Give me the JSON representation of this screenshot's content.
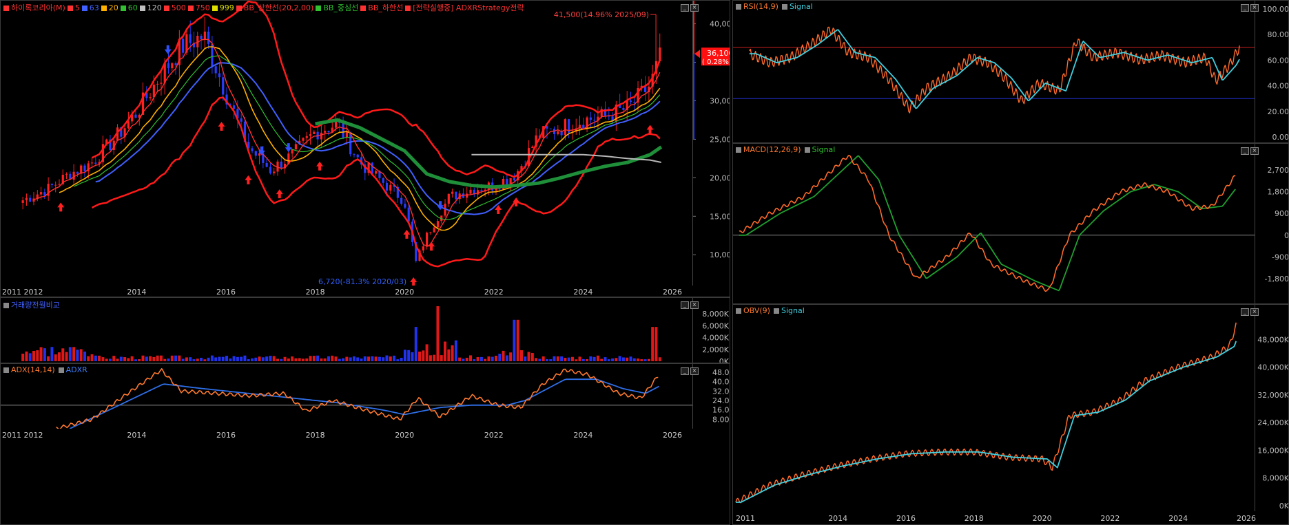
{
  "main": {
    "legend": [
      {
        "label": "하이록코리아(M)",
        "color": "#ff3030"
      },
      {
        "label": "5",
        "color": "#ff3030"
      },
      {
        "label": "63",
        "color": "#4060ff"
      },
      {
        "label": "20",
        "color": "#ffb000"
      },
      {
        "label": "60",
        "color": "#30c030"
      },
      {
        "label": "120",
        "color": "#c0c0c0"
      },
      {
        "label": "500",
        "color": "#ff3030"
      },
      {
        "label": "750",
        "color": "#ff3030"
      },
      {
        "label": "999",
        "color": "#e0e000"
      },
      {
        "label": "BB_상한선(20,2,00)",
        "color": "#ff3030"
      },
      {
        "label": "BB_중심선",
        "color": "#30c030"
      },
      {
        "label": "BB_하한선",
        "color": "#ff3030"
      },
      {
        "label": "[전략실행중] ADXRStrategy전략",
        "color": "#ff3030"
      }
    ],
    "high_label": "41,500(14.96% 2025/09)",
    "low_label": "6,720(-81.3% 2020/03)",
    "price_tag": "36,100",
    "price_tag_pct": "( 0.28%)",
    "y_ticks": [
      "40,000",
      "35,000",
      "30,000",
      "25,000",
      "20,000",
      "15,000",
      "10,000"
    ],
    "x_labels": [
      "2011 2012",
      "2014",
      "2016",
      "2018",
      "2020",
      "2022",
      "2024",
      "2026"
    ]
  },
  "volume": {
    "title": "거래량전월비교",
    "y_ticks": [
      "8,000K",
      "6,000K",
      "4,000K",
      "2,000K",
      "0K"
    ]
  },
  "adx": {
    "title1": "ADX(14,14)",
    "title2": "ADXR",
    "y_ticks": [
      "48.00",
      "40.00",
      "32.00",
      "24.00",
      "16.00",
      "8.00"
    ],
    "x_labels": [
      "2011 2012",
      "2014",
      "2016",
      "2018",
      "2020",
      "2022",
      "2024",
      "2026"
    ]
  },
  "rsi": {
    "title1": "RSI(14,9)",
    "title2": "Signal",
    "y_ticks": [
      "100.00",
      "80.00",
      "60.00",
      "40.00",
      "20.00",
      "0.00"
    ]
  },
  "macd": {
    "title1": "MACD(12,26,9)",
    "title2": "Signal",
    "y_ticks": [
      "2,700",
      "1,800",
      "900",
      "0",
      "-900",
      "-1,800"
    ]
  },
  "obv": {
    "title1": "OBV(9)",
    "title2": "Signal",
    "y_ticks": [
      "48,000K",
      "40,000K",
      "32,000K",
      "24,000K",
      "16,000K",
      "8,000K",
      "0K"
    ],
    "x_labels": [
      "2011",
      "2014",
      "2016",
      "2018",
      "2020",
      "2022",
      "2024",
      "2026"
    ]
  },
  "chart_data": {
    "type": "line",
    "title": "하이록코리아(M)",
    "x": [
      "2011-06",
      "2012-01",
      "2012-07",
      "2013-01",
      "2013-07",
      "2014-01",
      "2014-07",
      "2015-01",
      "2015-07",
      "2016-01",
      "2016-07",
      "2017-01",
      "2017-07",
      "2018-01",
      "2018-07",
      "2019-01",
      "2019-07",
      "2020-01",
      "2020-04",
      "2020-07",
      "2021-01",
      "2021-07",
      "2022-01",
      "2022-07",
      "2023-01",
      "2023-07",
      "2024-01",
      "2024-07",
      "2025-01",
      "2025-07",
      "2025-10"
    ],
    "series": [
      {
        "name": "하이록코리아(M)",
        "values": [
          17000,
          18500,
          20500,
          22000,
          25000,
          28500,
          33000,
          37000,
          38500,
          31000,
          24000,
          21000,
          23000,
          26000,
          27000,
          22000,
          19500,
          17000,
          9000,
          12500,
          17500,
          18500,
          19000,
          20500,
          25500,
          26500,
          27500,
          28000,
          29000,
          32000,
          36100
        ]
      },
      {
        "name": "BB_중심선",
        "values": [
          null,
          null,
          null,
          null,
          null,
          null,
          null,
          null,
          null,
          null,
          null,
          null,
          null,
          27000,
          27500,
          26500,
          25000,
          23500,
          22000,
          20500,
          19500,
          19000,
          18800,
          19000,
          19300,
          20000,
          20800,
          21500,
          22000,
          23000,
          24000
        ]
      },
      {
        "name": "63",
        "values": [
          null,
          null,
          null,
          null,
          null,
          null,
          24000,
          28000,
          31000,
          31500,
          30500,
          29000,
          27500,
          27000,
          26500,
          25000,
          23500,
          21500,
          19500,
          17500,
          16000,
          16000,
          16000,
          16500,
          18000,
          19500,
          22000,
          24000,
          26000,
          27500,
          28500
        ]
      },
      {
        "name": "120",
        "values": [
          null,
          null,
          null,
          null,
          null,
          null,
          null,
          null,
          null,
          null,
          null,
          null,
          null,
          null,
          null,
          null,
          null,
          null,
          null,
          null,
          null,
          23000,
          23000,
          23000,
          23000,
          23000,
          23000,
          22800,
          22500,
          22300,
          22000
        ]
      }
    ],
    "ylim": [
      6000,
      43000
    ],
    "volume": {
      "y_unit": "K",
      "ylim": [
        0,
        10000
      ]
    },
    "adx": {
      "ylim": [
        0,
        55
      ],
      "ref_line": 20
    },
    "rsi": {
      "ylim": [
        0,
        100
      ],
      "upper": 70,
      "lower": 30,
      "last": 70
    },
    "macd": {
      "ylim": [
        -2600,
        3500
      ],
      "last": 2500
    },
    "obv": {
      "ylim": [
        0,
        56000
      ],
      "last": 52000
    }
  }
}
